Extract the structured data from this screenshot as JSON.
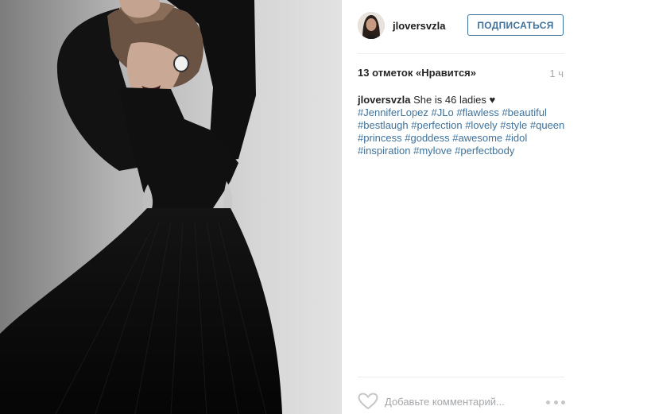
{
  "header": {
    "username": "jloversvzla",
    "follow_label": "ПОДПИСАТЬСЯ"
  },
  "stats": {
    "likes": "13 отметок «Нравится»",
    "time": "1 ч"
  },
  "caption": {
    "author": "jloversvzla",
    "text": "She is 46 ladies",
    "emoji": "♥",
    "hashtags": [
      "#JenniferLopez",
      "#JLo",
      "#flawless",
      "#beautiful",
      "#bestlaugh",
      "#perfection",
      "#lovely",
      "#style",
      "#queen",
      "#princess",
      "#goddess",
      "#awesome",
      "#idol",
      "#inspiration",
      "#mylove",
      "#perfectbody"
    ]
  },
  "comment": {
    "placeholder": "Добавьте комментарий..."
  },
  "icons": {
    "like": "heart-outline-icon",
    "more": "more-options-icon"
  },
  "colors": {
    "accent": "#3f729b",
    "text": "#262626",
    "muted": "#a5a7aa"
  }
}
